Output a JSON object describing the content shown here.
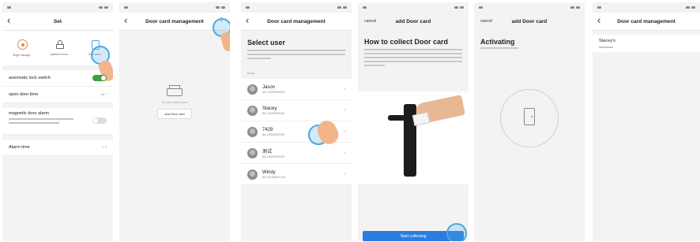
{
  "screens": {
    "set": {
      "title": "Set",
      "quick_items": [
        "finger manage...",
        "password man...",
        "Door card..."
      ],
      "automatic_lock_switch": {
        "label": "automatic lock switch",
        "on": true
      },
      "open_door_time": {
        "label": "open door time",
        "value": "5s"
      },
      "magnetic_alarm": {
        "label": "magnetic door alarm",
        "on": false
      },
      "alarm_time": {
        "label": "Alarm time",
        "value": "1"
      }
    },
    "door_card_management_empty": {
      "title": "Door card management",
      "empty_text": "No Door card record",
      "add_button": "add Door card"
    },
    "select_user": {
      "title": "Door card management",
      "heading": "Select user",
      "section_label": "family",
      "users": [
        {
          "name": "Jason",
          "phone": "86-13400000067"
        },
        {
          "name": "Stacey",
          "phone": "86-13400000067"
        },
        {
          "name": "7429",
          "phone": "86-13400000067"
        },
        {
          "name": "测试",
          "phone": "86-13400000067"
        },
        {
          "name": "Windy",
          "phone": "86-13799592784"
        }
      ]
    },
    "collect_card": {
      "cancel": "cancel",
      "title": "add Door card",
      "heading": "How to collect Door card",
      "start_button": "Start collecting"
    },
    "activating": {
      "cancel": "cancel",
      "title": "add Door card",
      "heading": "Activating"
    },
    "result": {
      "title": "Door card management",
      "card_name": "Stacey's"
    }
  },
  "colors": {
    "toggle_on": "#3aa13a",
    "primary_blue": "#2a7de1",
    "tap_ring": "#4aa8e0"
  }
}
